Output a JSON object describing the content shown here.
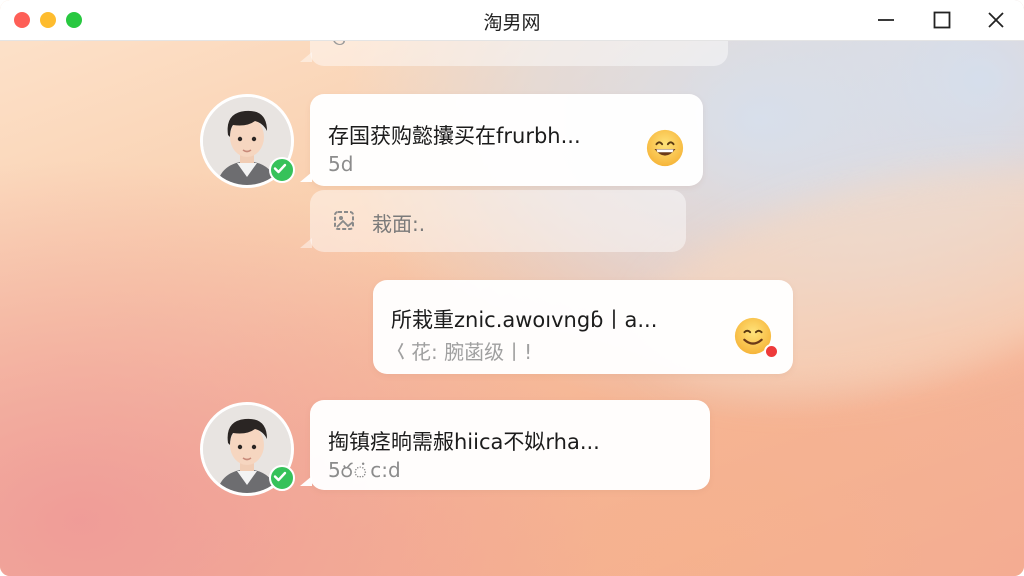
{
  "window": {
    "title": "淘男网"
  },
  "colors": {
    "close_red": "#fe5f57",
    "minimize_yellow": "#febc2e",
    "zoom_green": "#28c840",
    "verified_green": "#36c25a",
    "unread_red": "#ee3b3b"
  },
  "messages": [
    {
      "side": "left",
      "text": "存国获购懿攮买在frurbh...",
      "sub": "5d",
      "avatar_icon": "boy-avatar",
      "verified": true,
      "emoji": "grinning-face-emoji"
    },
    {
      "side": "left",
      "faded": true,
      "text": "",
      "sub": "栽面:.",
      "icon": "image-icon"
    },
    {
      "side": "right",
      "text": "所栽重znic.awoıvngɓ丨a...",
      "sub": "𡿨花: 腕菡级丨!",
      "emoji": "smiling-face-emoji",
      "unread_dot": true
    },
    {
      "side": "left",
      "text": "掏镇痉晌需赧hiica不姒rha...",
      "sub": "5ర்c:d",
      "avatar_icon": "boy-avatar",
      "verified": true
    }
  ],
  "top_partial": {
    "sub": "ଓ ·"
  }
}
